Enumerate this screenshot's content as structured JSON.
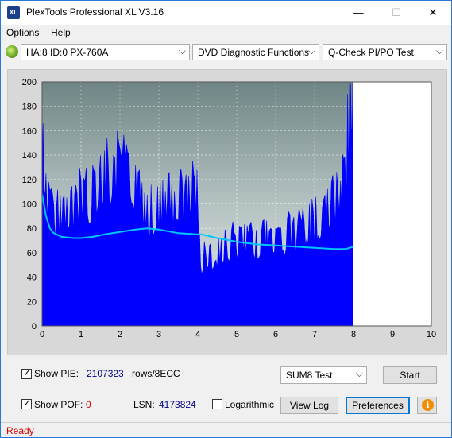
{
  "window": {
    "title": "PlexTools Professional XL V3.16",
    "icon_text": "XL",
    "minimize_glyph": "—",
    "maximize_glyph": "☐",
    "close_glyph": "✕"
  },
  "menu": {
    "items": [
      "Options",
      "Help"
    ]
  },
  "toolbar": {
    "drive": "HA:8 ID:0  PX-760A",
    "function": "DVD Diagnostic Functions",
    "test": "Q-Check PI/PO Test"
  },
  "chart_data": {
    "type": "area",
    "x_ticks": [
      "0",
      "1",
      "2",
      "3",
      "4",
      "5",
      "6",
      "7",
      "8",
      "9",
      "10"
    ],
    "y_ticks": [
      "0",
      "20",
      "40",
      "60",
      "80",
      "100",
      "120",
      "140",
      "160",
      "180",
      "200"
    ],
    "xlim": [
      0,
      10
    ],
    "ylim": [
      0,
      200
    ],
    "grid": true,
    "series": [
      {
        "kind": "pie-bars",
        "color": "#0000ff",
        "x": [
          0.0,
          0.05,
          0.1,
          0.2,
          0.3,
          0.4,
          0.5,
          0.6,
          0.7,
          0.8,
          0.9,
          1.0,
          1.1,
          1.2,
          1.3,
          1.4,
          1.5,
          1.6,
          1.7,
          1.8,
          1.9,
          2.0,
          2.1,
          2.2,
          2.3,
          2.4,
          2.5,
          2.6,
          2.7,
          2.8,
          2.9,
          3.0,
          3.1,
          3.2,
          3.3,
          3.4,
          3.5,
          3.6,
          3.7,
          3.8,
          3.9,
          3.98,
          4.02,
          4.1,
          4.2,
          4.3,
          4.4,
          4.5,
          4.6,
          4.7,
          4.8,
          4.9,
          5.0,
          5.1,
          5.2,
          5.3,
          5.4,
          5.5,
          5.6,
          5.7,
          5.8,
          5.9,
          6.0,
          6.1,
          6.2,
          6.3,
          6.4,
          6.5,
          6.6,
          6.7,
          6.8,
          6.9,
          7.0,
          7.1,
          7.2,
          7.3,
          7.4,
          7.5,
          7.6,
          7.7,
          7.75,
          7.8,
          7.85,
          7.9,
          7.95,
          7.98
        ],
        "y": [
          160,
          130,
          100,
          90,
          86,
          84,
          85,
          87,
          90,
          92,
          96,
          98,
          100,
          103,
          106,
          109,
          112,
          115,
          118,
          120,
          122,
          123,
          121,
          117,
          115,
          112,
          110,
          90,
          85,
          88,
          92,
          95,
          97,
          98,
          99,
          98,
          97,
          100,
          101,
          104,
          102,
          98,
          62,
          52,
          54,
          56,
          58,
          60,
          62,
          63,
          64,
          65,
          66,
          66,
          67,
          67,
          68,
          68,
          68,
          69,
          69,
          70,
          70,
          70,
          71,
          72,
          73,
          74,
          75,
          76,
          77,
          78,
          80,
          82,
          85,
          88,
          92,
          96,
          101,
          108,
          116,
          127,
          143,
          162,
          182,
          200
        ]
      },
      {
        "kind": "po-line",
        "color": "#00c8ff",
        "x": [
          0,
          0.1,
          0.2,
          0.3,
          0.5,
          0.8,
          1.0,
          1.3,
          1.6,
          2.0,
          2.4,
          2.7,
          3.0,
          3.5,
          4.0,
          4.1,
          4.5,
          5.0,
          5.5,
          6.0,
          6.5,
          7.0,
          7.5,
          7.8,
          8.0
        ],
        "y": [
          108,
          90,
          80,
          76,
          73,
          72,
          72,
          73,
          75,
          77,
          79,
          80,
          79,
          76,
          75,
          75,
          72,
          69,
          67,
          66,
          65,
          64,
          63,
          63,
          65
        ]
      }
    ]
  },
  "controls": {
    "show_pie_label": "Show PIE:",
    "pie_value": "2107323",
    "rows_label": "rows/8ECC",
    "show_pof_label": "Show POF:",
    "pof_value": "0",
    "lsn_label": "LSN:",
    "lsn_value": "4173824",
    "logarithmic_label": "Logarithmic",
    "sum_select": "SUM8 Test",
    "start_button": "Start",
    "view_log_button": "View Log",
    "preferences_button": "Preferences",
    "info_glyph": "i",
    "check_glyph": "✓"
  },
  "status": {
    "text": "Ready"
  },
  "colors": {
    "pie": "#0000ff",
    "po": "#00c8ff",
    "status": "#e00000",
    "value": "#00008b",
    "pof_value": "#cc0000"
  }
}
